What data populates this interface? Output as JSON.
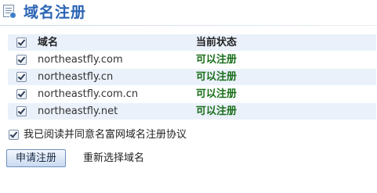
{
  "header": {
    "icon": "document-icon",
    "title": "域名注册"
  },
  "table": {
    "headers": {
      "domain": "域名",
      "status": "当前状态"
    },
    "rows": [
      {
        "domain": "northeastfly.com",
        "status": "可以注册",
        "checked": true
      },
      {
        "domain": "northeastfly.cn",
        "status": "可以注册",
        "checked": true
      },
      {
        "domain": "northeastfly.com.cn",
        "status": "可以注册",
        "checked": true
      },
      {
        "domain": "northeastfly.net",
        "status": "可以注册",
        "checked": true
      }
    ],
    "select_all_checked": true
  },
  "agreement": {
    "label": "我已阅读并同意名富网域名注册协议",
    "checked": true
  },
  "actions": {
    "submit_label": "申请注册",
    "reselect_label": "重新选择域名"
  },
  "colors": {
    "title": "#2a64b4",
    "status_ok": "#1a6e1a",
    "row_alt": "#eaf1fa"
  }
}
